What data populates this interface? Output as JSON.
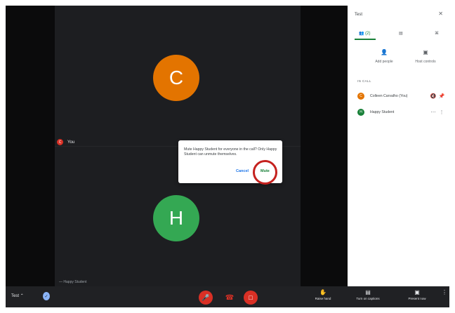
{
  "meeting": {
    "title": "Test"
  },
  "participants_grid": {
    "self_initial": "C",
    "self_label": "You",
    "self_tag_initial": "C",
    "other_initial": "H",
    "other_label": "Happy Student",
    "other_prefix": "—"
  },
  "dialog": {
    "message": "Mute Happy Student for everyone in the call? Only Happy Student can unmute themselves.",
    "cancel_label": "Cancel",
    "mute_label": "Mute"
  },
  "side_panel": {
    "title": "Test",
    "close_glyph": "✕",
    "tabs": {
      "people": "👥 (2)",
      "chat": "▤",
      "activities": "⌘"
    },
    "actions": {
      "add_people": {
        "icon": "person-add-icon",
        "label": "Add people"
      },
      "host_controls": {
        "icon": "host-controls-icon",
        "label": "Host controls"
      }
    },
    "section_label": "IN CALL",
    "people": [
      {
        "initial": "C",
        "name": "Colleen Carvalho (You)"
      },
      {
        "initial": "H",
        "name": "Happy Student"
      }
    ]
  },
  "controls": {
    "raise_hand": "Raise hand",
    "captions": "Turn on captions",
    "present": "Present now"
  },
  "colors": {
    "accent_green": "#188038",
    "danger": "#d93025",
    "avatar_c": "#e37400",
    "avatar_h": "#34a853"
  }
}
